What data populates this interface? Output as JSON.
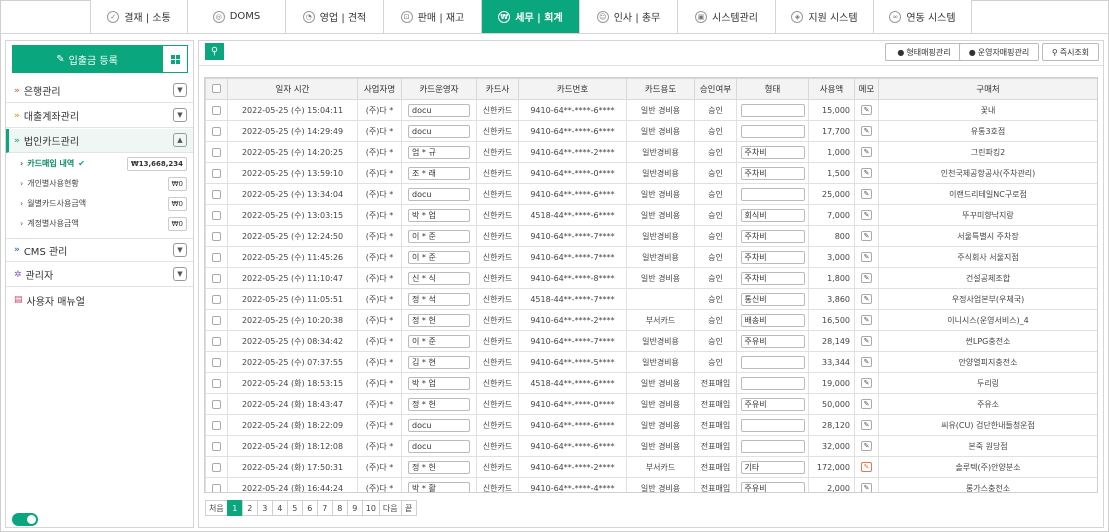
{
  "nav": {
    "tabs": [
      {
        "label": "결재 | 소통",
        "icon": "approval-icon"
      },
      {
        "label": "DOMS",
        "icon": "doms-icon"
      },
      {
        "label": "영업 | 견적",
        "icon": "sales-icon"
      },
      {
        "label": "판매 | 재고",
        "icon": "cart-icon"
      },
      {
        "label": "세무 | 회계",
        "icon": "won-icon",
        "active": true
      },
      {
        "label": "인사 | 총무",
        "icon": "hr-icon"
      },
      {
        "label": "시스템관리",
        "icon": "system-icon"
      },
      {
        "label": "지원 시스템",
        "icon": "support-icon"
      },
      {
        "label": "연동 시스템",
        "icon": "link-icon"
      }
    ]
  },
  "sidebar": {
    "register_label": "입출금 등록",
    "sections": [
      {
        "label": "은행관리",
        "open": false
      },
      {
        "label": "대출계좌관리",
        "open": false
      },
      {
        "label": "법인카드관리",
        "open": true
      },
      {
        "label": "CMS 관리",
        "open": false
      },
      {
        "label": "관리자",
        "open": false
      }
    ],
    "subitems": [
      {
        "label": "카드매입 내역",
        "amount": "₩13,668,234",
        "active": true
      },
      {
        "label": "개인별사용현황",
        "amount": "₩0"
      },
      {
        "label": "월별카드사용금액",
        "amount": "₩0"
      },
      {
        "label": "계정별사용금액",
        "amount": "₩0"
      }
    ],
    "manual_label": "사용자 매뉴얼"
  },
  "toolbar": {
    "type_mapping": "형태매핑관리",
    "vendor_mapping": "운영자매핑관리",
    "instant_search": "즉시조회"
  },
  "table": {
    "headers": [
      "일자 시간",
      "사업자명",
      "카드운영자",
      "카드사",
      "카드번호",
      "카드용도",
      "승인여부",
      "형태",
      "사용액",
      "메모",
      "구매처"
    ],
    "rows": [
      {
        "date": "2022-05-25 (수) 15:04:11",
        "biz": "(주)다 *",
        "op": "docu",
        "co": "신한카드",
        "num": "9410-64**-****-6****",
        "use": "일반 경비용",
        "appr": "승인",
        "type": "",
        "amt": "15,000",
        "shop": "꽃내"
      },
      {
        "date": "2022-05-25 (수) 14:29:49",
        "biz": "(주)다 *",
        "op": "docu",
        "co": "신한카드",
        "num": "9410-64**-****-6****",
        "use": "일반 경비용",
        "appr": "승인",
        "type": "",
        "amt": "17,700",
        "shop": "유통3호점"
      },
      {
        "date": "2022-05-25 (수) 14:20:25",
        "biz": "(주)다 *",
        "op": "엄 * 규",
        "co": "신한카드",
        "num": "9410-64**-****-2****",
        "use": "일반경비용",
        "appr": "승인",
        "type": "주차비",
        "amt": "1,000",
        "shop": "그린파킹2"
      },
      {
        "date": "2022-05-25 (수) 13:59:10",
        "biz": "(주)다 *",
        "op": "조 * 래",
        "co": "신한카드",
        "num": "9410-64**-****-0****",
        "use": "일반경비용",
        "appr": "승인",
        "type": "주차비",
        "amt": "1,500",
        "shop": "인천국제공항공사(주차관리)"
      },
      {
        "date": "2022-05-25 (수) 13:34:04",
        "biz": "(주)다 *",
        "op": "docu",
        "co": "신한카드",
        "num": "9410-64**-****-6****",
        "use": "일반 경비용",
        "appr": "승인",
        "type": "",
        "amt": "25,000",
        "shop": "이랜드리테일NC구로점"
      },
      {
        "date": "2022-05-25 (수) 13:03:15",
        "biz": "(주)다 *",
        "op": "박 * 업",
        "co": "신한카드",
        "num": "4518-44**-****-6****",
        "use": "일반 경비용",
        "appr": "승인",
        "type": "회식비",
        "amt": "7,000",
        "shop": "뚜꾸미향낙지랑"
      },
      {
        "date": "2022-05-25 (수) 12:24:50",
        "biz": "(주)다 *",
        "op": "이 * 준",
        "co": "신한카드",
        "num": "9410-64**-****-7****",
        "use": "일반경비용",
        "appr": "승인",
        "type": "주차비",
        "amt": "800",
        "shop": "서울특별시 주차장"
      },
      {
        "date": "2022-05-25 (수) 11:45:26",
        "biz": "(주)다 *",
        "op": "이 * 준",
        "co": "신한카드",
        "num": "9410-64**-****-7****",
        "use": "일반경비용",
        "appr": "승인",
        "type": "주차비",
        "amt": "3,000",
        "shop": "주식회사 서울지점"
      },
      {
        "date": "2022-05-25 (수) 11:10:47",
        "biz": "(주)다 *",
        "op": "신 * 식",
        "co": "신한카드",
        "num": "9410-64**-****-8****",
        "use": "일반 경비용",
        "appr": "승인",
        "type": "주차비",
        "amt": "1,800",
        "shop": "건설공제조합"
      },
      {
        "date": "2022-05-25 (수) 11:05:51",
        "biz": "(주)다 *",
        "op": "정 * 석",
        "co": "신한카드",
        "num": "4518-44**-****-7****",
        "use": "",
        "appr": "승인",
        "type": "통신비",
        "amt": "3,860",
        "shop": "우정사업본부(우체국)"
      },
      {
        "date": "2022-05-25 (수) 10:20:38",
        "biz": "(주)다 *",
        "op": "정 * 헌",
        "co": "신한카드",
        "num": "9410-64**-****-2****",
        "use": "부서카드",
        "appr": "승인",
        "type": "배송비",
        "amt": "16,500",
        "shop": "이니시스(운영서비스)_4"
      },
      {
        "date": "2022-05-25 (수) 08:34:42",
        "biz": "(주)다 *",
        "op": "이 * 준",
        "co": "신한카드",
        "num": "9410-64**-****-7****",
        "use": "일반경비용",
        "appr": "승인",
        "type": "주유비",
        "amt": "28,149",
        "shop": "썬LPG충전소"
      },
      {
        "date": "2022-05-25 (수) 07:37:55",
        "biz": "(주)다 *",
        "op": "김 * 현",
        "co": "신한카드",
        "num": "9410-64**-****-5****",
        "use": "일반경비용",
        "appr": "승인",
        "type": "",
        "amt": "33,344",
        "shop": "안양열피지충전소"
      },
      {
        "date": "2022-05-24 (화) 18:53:15",
        "biz": "(주)다 *",
        "op": "박 * 업",
        "co": "신한카드",
        "num": "4518-44**-****-6****",
        "use": "일반 경비용",
        "appr": "전표매입",
        "type": "",
        "amt": "19,000",
        "shop": "두리링"
      },
      {
        "date": "2022-05-24 (화) 18:43:47",
        "biz": "(주)다 *",
        "op": "정 * 헌",
        "co": "신한카드",
        "num": "9410-64**-****-0****",
        "use": "일반 경비용",
        "appr": "전표매입",
        "type": "주유비",
        "amt": "50,000",
        "shop": "주유소"
      },
      {
        "date": "2022-05-24 (화) 18:22:09",
        "biz": "(주)다 *",
        "op": "docu",
        "co": "신한카드",
        "num": "9410-64**-****-6****",
        "use": "일반 경비용",
        "appr": "전표매입",
        "type": "",
        "amt": "28,120",
        "shop": "씨유(CU) 검단한내들청운점"
      },
      {
        "date": "2022-05-24 (화) 18:12:08",
        "biz": "(주)다 *",
        "op": "docu",
        "co": "신한카드",
        "num": "9410-64**-****-6****",
        "use": "일반 경비용",
        "appr": "전표매입",
        "type": "",
        "amt": "32,000",
        "shop": "본죽 원당점"
      },
      {
        "date": "2022-05-24 (화) 17:50:31",
        "biz": "(주)다 *",
        "op": "정 * 헌",
        "co": "신한카드",
        "num": "9410-64**-****-2****",
        "use": "부서카드",
        "appr": "전표매입",
        "type": "기타",
        "amt": "172,000",
        "shop": "솔루텍(주)안양분소",
        "memo_red": true
      },
      {
        "date": "2022-05-24 (화) 16:44:24",
        "biz": "(주)다 *",
        "op": "박 * 활",
        "co": "신한카드",
        "num": "9410-64**-****-4****",
        "use": "일반 경비용",
        "appr": "전표매입",
        "type": "주유비",
        "amt": "2,000",
        "shop": "롱가스충전소"
      }
    ]
  },
  "pager": {
    "first": "처음",
    "pages": [
      "1",
      "2",
      "3",
      "4",
      "5",
      "6",
      "7",
      "8",
      "9",
      "10"
    ],
    "next": "다음",
    "last": "끝"
  }
}
